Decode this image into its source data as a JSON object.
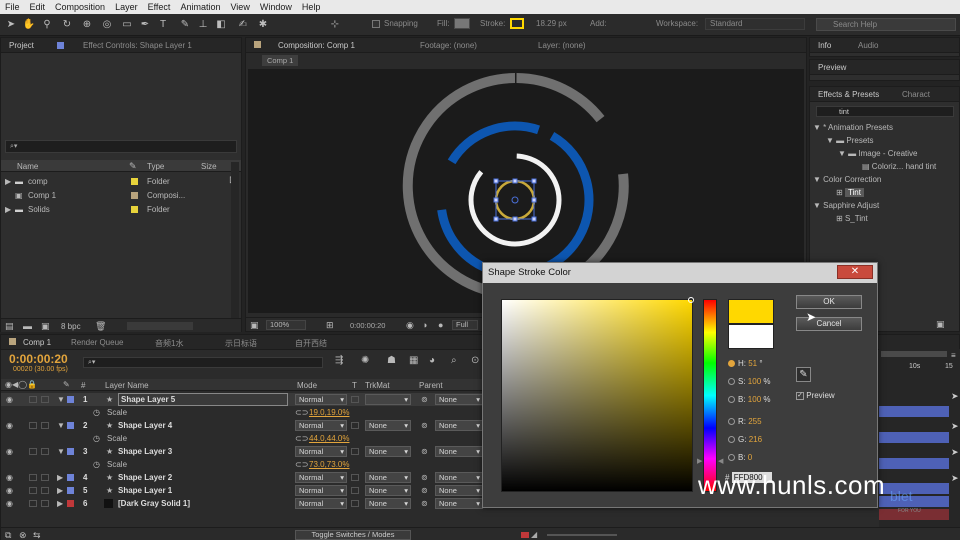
{
  "menu": [
    "File",
    "Edit",
    "Composition",
    "Layer",
    "Effect",
    "Animation",
    "View",
    "Window",
    "Help"
  ],
  "toolbar": {
    "snapping_label": "Snapping",
    "fill_label": "Fill:",
    "stroke_label": "Stroke:",
    "stroke_width": "18.29 px",
    "add_label": "Add:",
    "workspace_label": "Workspace:",
    "workspace_value": "Standard",
    "search_placeholder": "Search Help"
  },
  "project_panel": {
    "tab_project": "Project",
    "tab_effect_controls": "Effect Controls: Shape Layer 1",
    "col_name": "Name",
    "col_type": "Type",
    "col_size": "Size",
    "items": [
      {
        "name": "comp",
        "type": "Folder",
        "color": "#e8d33b"
      },
      {
        "name": "Comp 1",
        "type": "Composi...",
        "color": "#b9a47d"
      },
      {
        "name": "Solids",
        "type": "Folder",
        "color": "#e8d33b"
      }
    ],
    "bpc": "8 bpc"
  },
  "comp_panel": {
    "tab_comp": "Composition: Comp 1",
    "tab_footage": "Footage: (none)",
    "tab_layer": "Layer: (none)",
    "comp_button": "Comp 1",
    "zoom": "100%",
    "timecode": "0:00:00:20",
    "resolution": "Full"
  },
  "right_panels": {
    "tab_info": "Info",
    "tab_audio": "Audio",
    "tab_preview": "Preview",
    "tab_effects": "Effects & Presets",
    "tab_character": "Charact",
    "search_value": "tint",
    "tree": [
      {
        "label": "* Animation Presets",
        "indent": 0
      },
      {
        "label": "Presets",
        "indent": 1
      },
      {
        "label": "Image - Creative",
        "indent": 2
      },
      {
        "label": "Coloriz... hand tint",
        "indent": 3
      },
      {
        "label": "Color Correction",
        "indent": 0
      },
      {
        "label": "Tint",
        "indent": 2
      },
      {
        "label": "Sapphire Adjust",
        "indent": 0
      },
      {
        "label": "S_Tint",
        "indent": 2
      }
    ]
  },
  "timeline": {
    "tab_comp": "Comp 1",
    "tab_render": "Render Queue",
    "tab_extra1": "音频1水",
    "tab_extra2": "示日标语",
    "tab_extra3": "自开西结",
    "timecode": "0:00:00:20",
    "frames": "00020 (30.00 fps)",
    "col_layer_name": "Layer Name",
    "col_mode": "Mode",
    "col_t": "T",
    "col_trkmat": "TrkMat",
    "col_parent": "Parent",
    "ruler_label": "10s",
    "ruler_label2": "15",
    "layers": [
      {
        "num": "1",
        "name": "Shape Layer 5",
        "mode": "Normal",
        "trkmat": "",
        "parent": "None",
        "color": "#6e83d8",
        "scale": "19.0,19.0%"
      },
      {
        "num": "2",
        "name": "Shape Layer 4",
        "mode": "Normal",
        "trkmat": "None",
        "parent": "None",
        "color": "#6e83d8",
        "scale": "44.0,44.0%"
      },
      {
        "num": "3",
        "name": "Shape Layer 3",
        "mode": "Normal",
        "trkmat": "None",
        "parent": "None",
        "color": "#6e83d8",
        "scale": "73.0,73.0%"
      },
      {
        "num": "4",
        "name": "Shape Layer 2",
        "mode": "Normal",
        "trkmat": "None",
        "parent": "None",
        "color": "#6e83d8"
      },
      {
        "num": "5",
        "name": "Shape Layer 1",
        "mode": "Normal",
        "trkmat": "None",
        "parent": "None",
        "color": "#6e83d8"
      },
      {
        "num": "6",
        "name": "[Dark Gray Solid 1]",
        "mode": "Normal",
        "trkmat": "None",
        "parent": "None",
        "color": "#c0383a"
      }
    ],
    "scale_label": "Scale",
    "toggle_label": "Toggle Switches / Modes"
  },
  "dialog": {
    "title": "Shape Stroke Color",
    "ok": "OK",
    "cancel": "Cancel",
    "h_label": "H:",
    "h_value": "51",
    "h_unit": "°",
    "s_label": "S:",
    "s_value": "100",
    "s_unit": "%",
    "b_label": "B:",
    "b_value": "100",
    "b_unit": "%",
    "r_label": "R:",
    "r_value": "255",
    "g_label": "G:",
    "g_value": "216",
    "bl_label": "B:",
    "bl_value": "0",
    "hex_prefix": "#",
    "hex_value": "FFD800",
    "preview_label": "Preview",
    "new_color": "#FFD800",
    "old_color": "#FFFFFF"
  },
  "watermark": "www.hunls.com",
  "watermark_small": "FOR YOU",
  "watermark_logo": "blet"
}
